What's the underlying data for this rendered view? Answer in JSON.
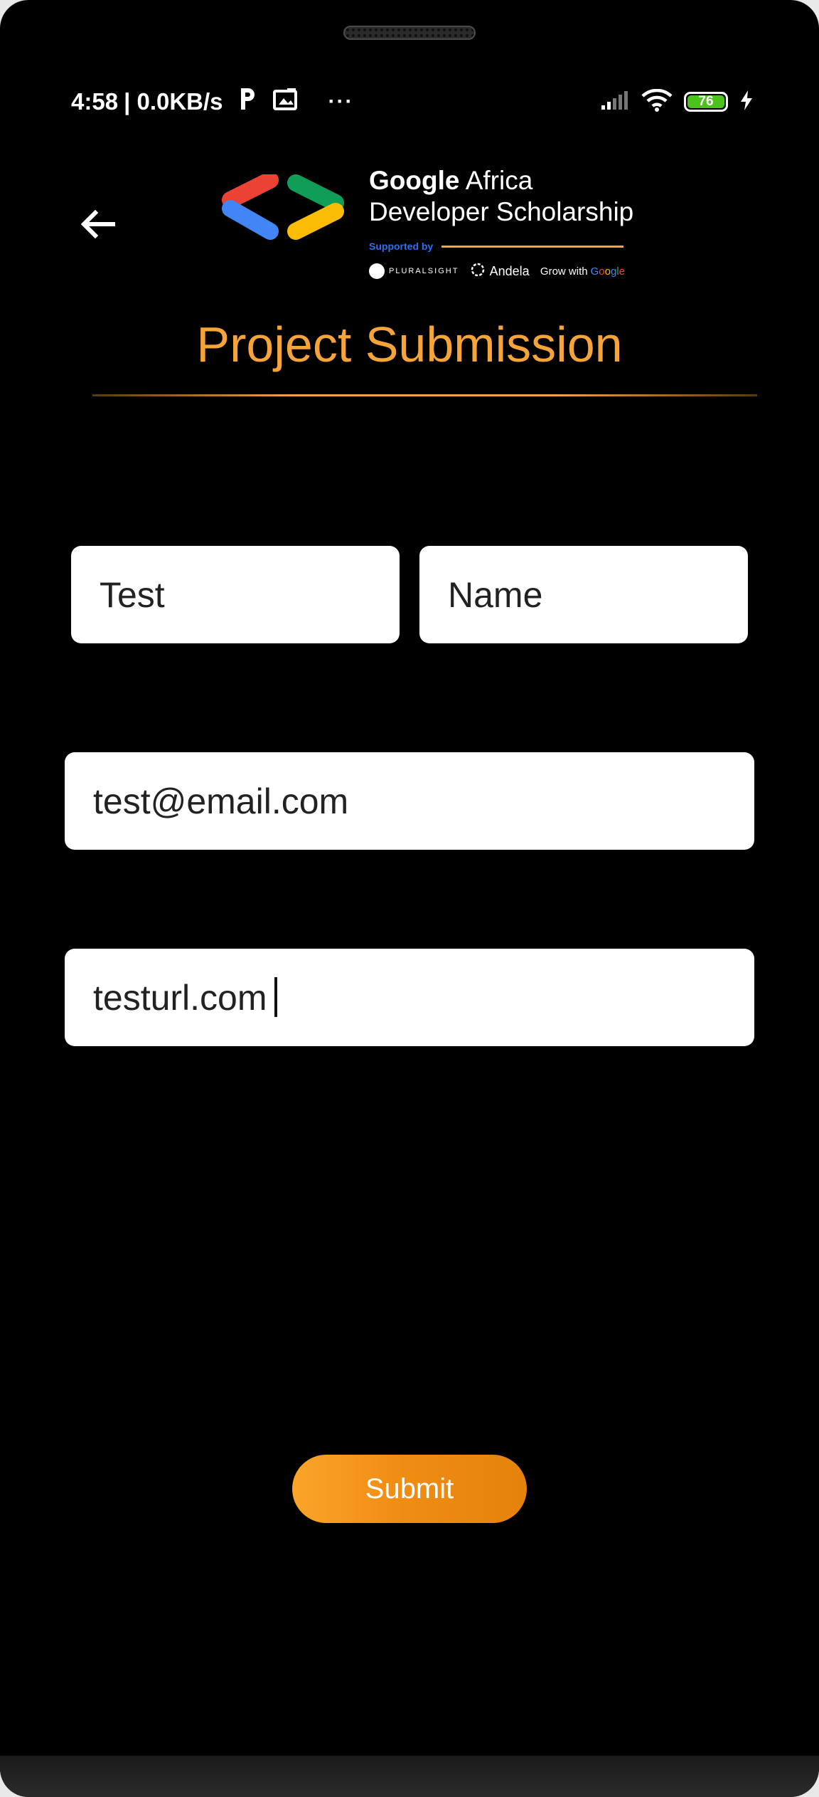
{
  "status_bar": {
    "time": "4:58",
    "net_speed": "| 0.0KB/s",
    "battery": "76",
    "more": "···"
  },
  "header": {
    "brand_google": "Google",
    "brand_africa": "Africa",
    "brand_line2": "Developer Scholarship",
    "supported_by": "Supported by",
    "partner_pluralsight": "PLURALSIGHT",
    "partner_andela": "Andela",
    "grow_with": "Grow with",
    "google_letters": [
      "G",
      "o",
      "o",
      "g",
      "l",
      "e"
    ]
  },
  "page_title": "Project Submission",
  "form": {
    "first_name": "Test",
    "last_name": "Name",
    "email": "test@email.com",
    "url": "testurl.com"
  },
  "submit_label": "Submit",
  "colors": {
    "accent": "#f5a43a",
    "background": "#000000",
    "button_start": "#fba52a",
    "button_end": "#e5820a"
  }
}
